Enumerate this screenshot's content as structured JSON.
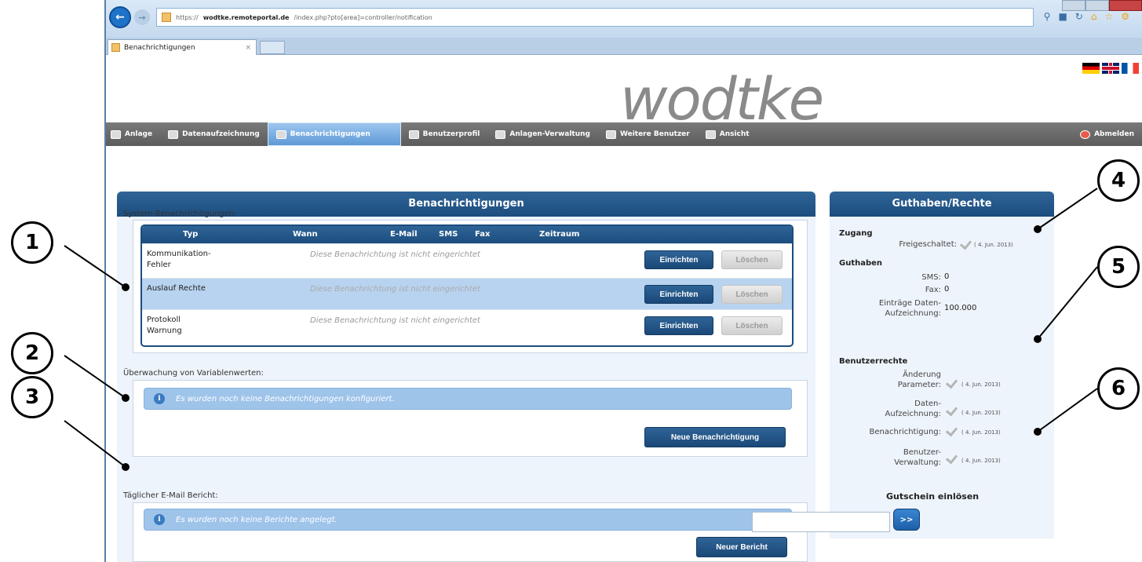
{
  "browser": {
    "url_prefix": "https://",
    "url_domain": "wodtke.remoteportal.de",
    "url_path": "/index.php?pto[area]=controller/notification",
    "tab_title": "Benachrichtigungen",
    "back_icon": "back-arrow-icon",
    "forward_icon": "forward-arrow-icon",
    "addr_icons": "search refresh",
    "toolbar_icons": "home star gear"
  },
  "header": {
    "logo": "wodtke",
    "flags": [
      "de",
      "gb",
      "fr"
    ]
  },
  "menu": {
    "items": [
      {
        "label": "Anlage",
        "icon": "plant-icon"
      },
      {
        "label": "Datenaufzeichnung",
        "icon": "data-icon"
      },
      {
        "label": "Benachrichtigungen",
        "icon": "notification-icon"
      },
      {
        "label": "Benutzerprofil",
        "icon": "user-icon"
      },
      {
        "label": "Anlagen-Verwaltung",
        "icon": "plant-admin-icon"
      },
      {
        "label": "Weitere Benutzer",
        "icon": "users-icon"
      },
      {
        "label": "Ansicht",
        "icon": "view-icon"
      },
      {
        "label": "Abmelden",
        "icon": "logout-icon"
      }
    ],
    "active_index": 2
  },
  "main": {
    "title": "Benachrichtigungen",
    "system_label": "System-Benachrichtigungen:",
    "columns": [
      "Typ",
      "Wann",
      "E-Mail",
      "SMS",
      "Fax",
      "Zeitraum"
    ],
    "rows": [
      {
        "typ": "Kommunikation-\nFehler",
        "message": "Diese Benachrichtung ist nicht eingerichtet",
        "setup": "Einrichten",
        "delete": "Löschen"
      },
      {
        "typ": "Auslauf Rechte",
        "message": "Diese Benachrichtung ist nicht eingerichtet",
        "setup": "Einrichten",
        "delete": "Löschen"
      },
      {
        "typ": "Protokoll\nWarnung",
        "message": "Diese Benachrichtung ist nicht eingerichtet",
        "setup": "Einrichten",
        "delete": "Löschen"
      }
    ],
    "selected_row": 1,
    "monitor_label": "Überwachung von Variablenwerten:",
    "monitor_info": "Es wurden noch keine Benachrichtigungen konfiguriert.",
    "monitor_button": "Neue Benachrichtigung",
    "daily_label": "Täglicher E-Mail Bericht:",
    "daily_info": "Es wurden noch keine Berichte angelegt.",
    "daily_button": "Neuer Bericht"
  },
  "side": {
    "title": "Guthaben/Rechte",
    "access_heading": "Zugang",
    "access_label": "Freigeschaltet:",
    "access_date": "( 4. Jun. 2013)",
    "credit_heading": "Guthaben",
    "sms_label": "SMS:",
    "sms_value": "0",
    "fax_label": "Fax:",
    "fax_value": "0",
    "entries_label_1": "Einträge Daten-",
    "entries_label_2": "Aufzeichnung:",
    "entries_value": "100.000",
    "rights_heading": "Benutzerrechte",
    "rights": [
      {
        "l1": "Änderung",
        "l2": "Parameter:",
        "date": "( 4. Jun. 2013)"
      },
      {
        "l1": "Daten-",
        "l2": "Aufzeichnung:",
        "date": "( 4. Jun. 2013)"
      },
      {
        "l1": "",
        "l2": "Benachrichtigung:",
        "date": "( 4. Jun. 2013)"
      },
      {
        "l1": "Benutzer-",
        "l2": "Verwaltung:",
        "date": "( 4. Jun. 2013)"
      }
    ],
    "voucher_title": "Gutschein einlösen",
    "voucher_value": "",
    "voucher_button": ">>"
  },
  "callouts": [
    "1",
    "2",
    "3",
    "4",
    "5",
    "6"
  ]
}
